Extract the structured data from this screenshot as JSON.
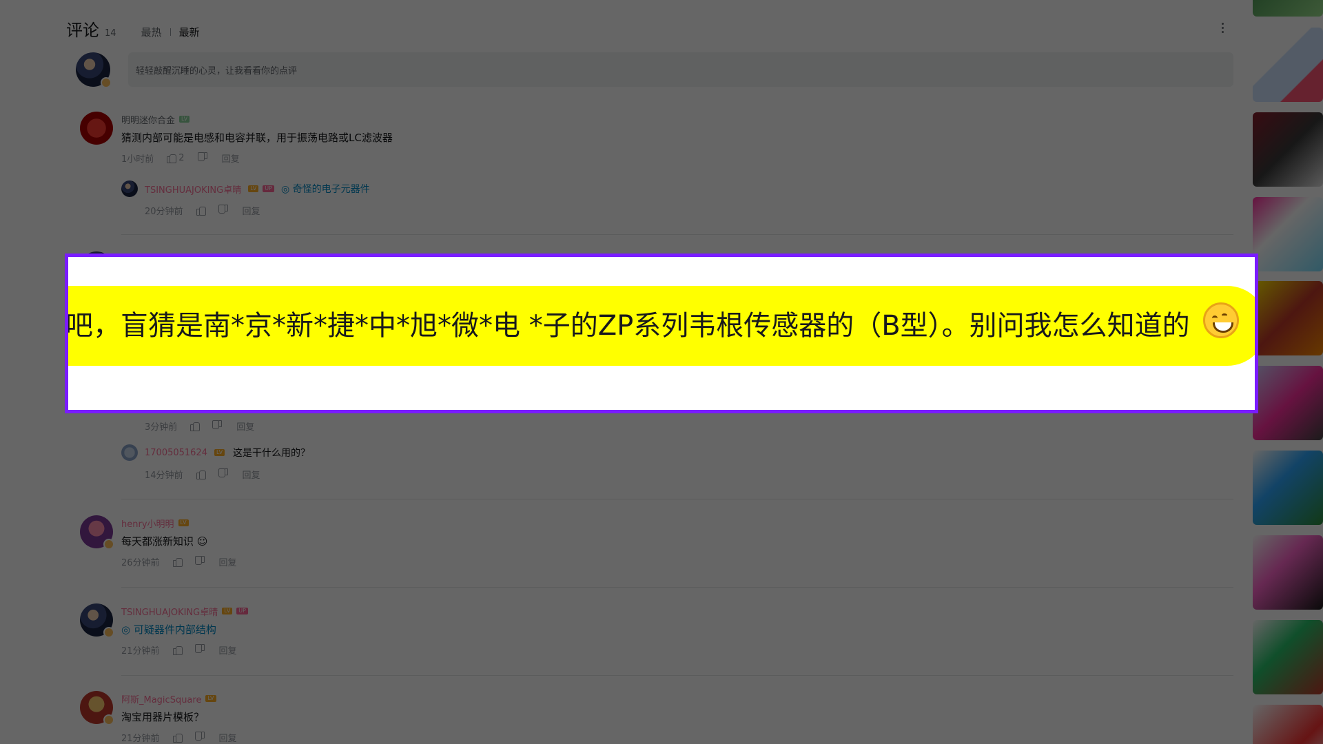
{
  "header": {
    "title": "评论",
    "count": "14",
    "tabs": [
      {
        "label": "最热"
      },
      {
        "label": "最新"
      }
    ]
  },
  "composer": {
    "placeholder": "轻轻敲醒沉睡的心灵，让我看看你的点评"
  },
  "comments": [
    {
      "user": "明明迷你合金",
      "text": "猜测内部可能是电感和电容并联，用于振荡电路或LC滤波器",
      "time": "1小时前",
      "likes": "2",
      "reply_label": "回复",
      "replies": [
        {
          "user": "TSINGHUAJOKING卓晴",
          "link": "◎ 奇怪的电子元器件",
          "time": "20分钟前",
          "reply_label": "回复"
        }
      ]
    },
    {
      "hidden_reply_meta": {
        "time": "3分钟前",
        "reply_label": "回复"
      },
      "replies": [
        {
          "user": "17005051624",
          "text": "这是干什么用的？",
          "time": "14分钟前",
          "reply_label": "回复"
        }
      ]
    },
    {
      "user": "henry小明明",
      "text": "每天都涨新知识",
      "time": "26分钟前",
      "reply_label": "回复"
    },
    {
      "user": "TSINGHUAJOKING卓晴",
      "link": "◎ 可疑器件内部结构",
      "time": "21分钟前",
      "reply_label": "回复"
    },
    {
      "user": "阿斯_MagicSquare",
      "text": "淘宝用器片模板？",
      "time": "21分钟前",
      "reply_label": "回复"
    }
  ],
  "zoom": {
    "text": "吧，盲猜是南*京*新*捷*中*旭*微*电 *子的ZP系列韦根传感器的（B型）。别问我怎么知道的",
    "highlight_color": "#ffff00",
    "border_color": "#7a1cff"
  },
  "colors": {
    "username": "#fb7299",
    "link": "#008ac5",
    "overlay": "rgba(0,0,0,0.6)"
  },
  "icons": [
    "more-vertical-icon",
    "thumb-up-icon",
    "thumb-down-icon",
    "smiling-emoji-icon"
  ]
}
